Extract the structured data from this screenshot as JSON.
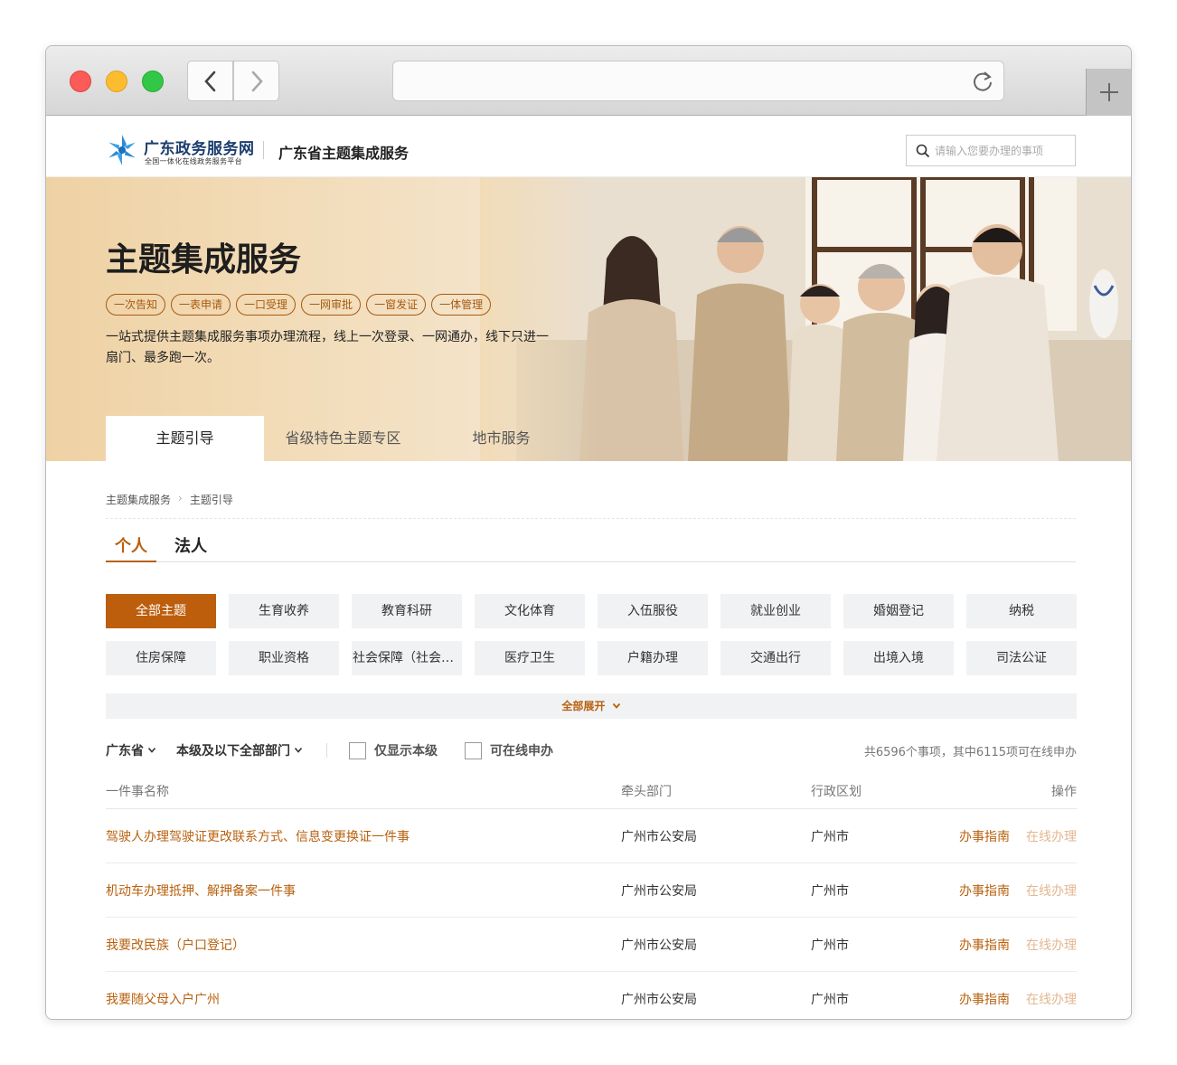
{
  "header": {
    "logo_title": "广东政务服务网",
    "logo_subtitle": "全国一体化在线政务服务平台",
    "site_title": "广东省主题集成服务",
    "search_placeholder": "请输入您要办理的事项"
  },
  "banner": {
    "title": "主题集成服务",
    "tags": [
      "一次告知",
      "一表申请",
      "一口受理",
      "一网审批",
      "一窗发证",
      "一体管理"
    ],
    "description": "一站式提供主题集成服务事项办理流程，线上一次登录、一网通办，线下只进一扇门、最多跑一次。",
    "tabs": [
      "主题引导",
      "省级特色主题专区",
      "地市服务"
    ]
  },
  "breadcrumb": [
    "主题集成服务",
    "主题引导"
  ],
  "person_tabs": [
    "个人",
    "法人"
  ],
  "categories": [
    "全部主题",
    "生育收养",
    "教育科研",
    "文化体育",
    "入伍服役",
    "就业创业",
    "婚姻登记",
    "纳税",
    "住房保障",
    "职业资格",
    "社会保障（社会保险）",
    "医疗卫生",
    "户籍办理",
    "交通出行",
    "出境入境",
    "司法公证"
  ],
  "expand_label": "全部展开",
  "filters": {
    "region": "广东省",
    "department": "本级及以下全部部门",
    "only_level": "仅显示本级",
    "online_only": "可在线申办",
    "count_text": "共6596个事项，其中6115项可在线申办"
  },
  "table": {
    "headers": [
      "一件事名称",
      "牵头部门",
      "行政区划",
      "操作"
    ],
    "rows": [
      {
        "name": "驾驶人办理驾驶证更改联系方式、信息变更换证一件事",
        "dept": "广州市公安局",
        "region": "广州市",
        "guide": "办事指南",
        "online": "在线办理"
      },
      {
        "name": "机动车办理抵押、解押备案一件事",
        "dept": "广州市公安局",
        "region": "广州市",
        "guide": "办事指南",
        "online": "在线办理"
      },
      {
        "name": "我要改民族（户口登记）",
        "dept": "广州市公安局",
        "region": "广州市",
        "guide": "办事指南",
        "online": "在线办理"
      },
      {
        "name": "我要随父母入户广州",
        "dept": "广州市公安局",
        "region": "广州市",
        "guide": "办事指南",
        "online": "在线办理"
      }
    ]
  },
  "colors": {
    "accent": "#b8610e",
    "active_category": "#bd5e0c"
  }
}
